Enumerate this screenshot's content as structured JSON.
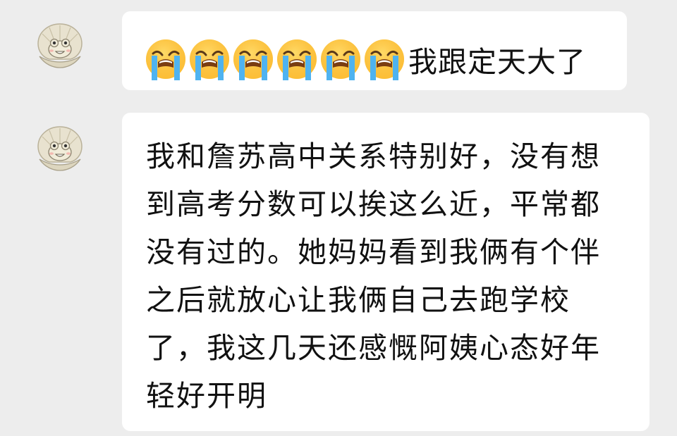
{
  "chat": {
    "messages": [
      {
        "sender": "other",
        "avatar": "seashell-frog-avatar",
        "emojis": [
          "loudly-crying-face",
          "loudly-crying-face",
          "loudly-crying-face",
          "loudly-crying-face",
          "loudly-crying-face",
          "loudly-crying-face"
        ],
        "text": "我跟定天大了"
      },
      {
        "sender": "other",
        "avatar": "seashell-frog-avatar",
        "lines": [
          "我和詹苏高中关系特别好，没有想",
          "到高考分数可以挨这么近，平常都",
          "没有过的。她妈妈看到我俩有个伴",
          "之后就放心让我俩自己去跑学校",
          "了，我这几天还感慨阿姨心态好年",
          "轻好开明"
        ]
      }
    ]
  },
  "colors": {
    "background": "#ededed",
    "bubble": "#ffffff",
    "text": "#111111"
  }
}
